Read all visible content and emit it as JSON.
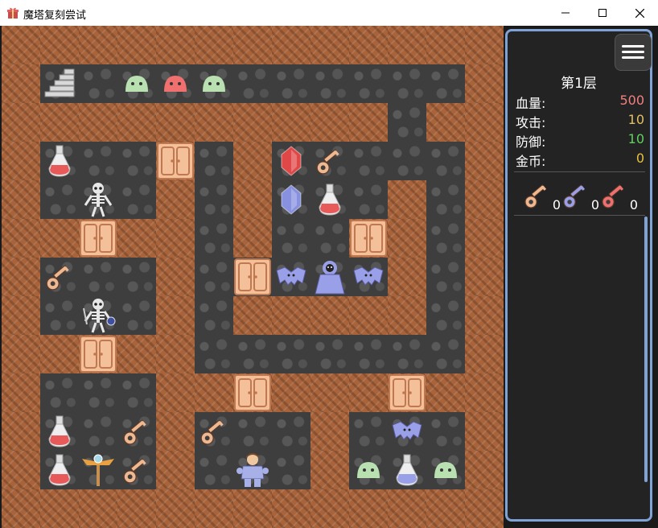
{
  "window": {
    "title": "魔塔复刻尝试",
    "icon": "gift-icon",
    "controls": [
      "minimize-icon",
      "maximize-icon",
      "close-icon"
    ]
  },
  "hud": {
    "floor": "第1层",
    "stats": [
      {
        "label": "血量:",
        "value": "500",
        "color": "#f08080"
      },
      {
        "label": "攻击:",
        "value": "10",
        "color": "#e0c060"
      },
      {
        "label": "防御:",
        "value": "10",
        "color": "#60d060"
      },
      {
        "label": "金币:",
        "value": "0",
        "color": "#e8c040"
      }
    ],
    "keys": [
      {
        "name": "yellow-key",
        "count": "0",
        "color": "#f0b890"
      },
      {
        "name": "blue-key",
        "count": "0",
        "color": "#9aa0e8"
      },
      {
        "name": "red-key",
        "count": "0",
        "color": "#f07070"
      }
    ]
  },
  "map": {
    "legend": {
      "W": "wall",
      "F": "floor"
    },
    "grid": [
      "WWWWWWWWWWWWW",
      "WFFFFFFFFFFFW",
      "WWWWWWWWWWFWW",
      "WFFFWFWFFFFFW",
      "WFFFWFWFFFWFW",
      "WWWWWFWFFWWFW",
      "WFFFWFFFFFWFW",
      "WFFFWFWWWWWFW",
      "WWWWWFFFFFFFW",
      "WFFFWWWWWWWWW",
      "WFFFWFFFWFFFW",
      "WFFFWFFFWFFFW",
      "WWWWWWWWWWWWW"
    ],
    "entities": [
      {
        "name": "upstairs",
        "row": 1,
        "col": 1,
        "color": "#d8d8d8"
      },
      {
        "name": "green-slime",
        "row": 1,
        "col": 3,
        "color": "#b8e0b0"
      },
      {
        "name": "red-slime",
        "row": 1,
        "col": 4,
        "color": "#f07070"
      },
      {
        "name": "green-slime",
        "row": 1,
        "col": 5,
        "color": "#b8e0b0"
      },
      {
        "name": "red-potion",
        "row": 3,
        "col": 1,
        "color": "#e85a5a"
      },
      {
        "name": "yellow-door",
        "row": 3,
        "col": 4,
        "color": "#f4c09a"
      },
      {
        "name": "red-gem",
        "row": 3,
        "col": 7,
        "color": "#e04848"
      },
      {
        "name": "yellow-key",
        "row": 3,
        "col": 8,
        "color": "#f0b890"
      },
      {
        "name": "skeleton",
        "row": 4,
        "col": 2,
        "color": "#e8e8e8"
      },
      {
        "name": "blue-gem",
        "row": 4,
        "col": 7,
        "color": "#8890e0"
      },
      {
        "name": "red-potion",
        "row": 4,
        "col": 8,
        "color": "#e85a5a"
      },
      {
        "name": "yellow-door",
        "row": 5,
        "col": 2,
        "color": "#f4c09a"
      },
      {
        "name": "yellow-door",
        "row": 5,
        "col": 9,
        "color": "#f4c09a"
      },
      {
        "name": "yellow-key",
        "row": 6,
        "col": 1,
        "color": "#f0b890"
      },
      {
        "name": "yellow-door",
        "row": 6,
        "col": 6,
        "color": "#f4c09a"
      },
      {
        "name": "bat",
        "row": 6,
        "col": 7,
        "color": "#9aa0e8"
      },
      {
        "name": "priest",
        "row": 6,
        "col": 8,
        "color": "#9aa0e8"
      },
      {
        "name": "bat",
        "row": 6,
        "col": 9,
        "color": "#9aa0e8"
      },
      {
        "name": "skeleton-soldier",
        "row": 7,
        "col": 2,
        "color": "#e8e8e8"
      },
      {
        "name": "yellow-door",
        "row": 8,
        "col": 2,
        "color": "#f4c09a"
      },
      {
        "name": "yellow-door",
        "row": 9,
        "col": 6,
        "color": "#f4c09a"
      },
      {
        "name": "yellow-door",
        "row": 9,
        "col": 10,
        "color": "#f4c09a"
      },
      {
        "name": "red-potion",
        "row": 10,
        "col": 1,
        "color": "#e85a5a"
      },
      {
        "name": "yellow-key",
        "row": 10,
        "col": 3,
        "color": "#f0b890"
      },
      {
        "name": "yellow-key",
        "row": 10,
        "col": 5,
        "color": "#f0b890"
      },
      {
        "name": "bat",
        "row": 10,
        "col": 10,
        "color": "#9aa0e8"
      },
      {
        "name": "red-potion",
        "row": 11,
        "col": 1,
        "color": "#e85a5a"
      },
      {
        "name": "winged-staff",
        "row": 11,
        "col": 2,
        "color": "#c89050"
      },
      {
        "name": "yellow-key",
        "row": 11,
        "col": 3,
        "color": "#f0b890"
      },
      {
        "name": "hero",
        "row": 11,
        "col": 6,
        "color": "#a8b0e8"
      },
      {
        "name": "green-slime",
        "row": 11,
        "col": 9,
        "color": "#b8e0b0"
      },
      {
        "name": "blue-potion",
        "row": 11,
        "col": 10,
        "color": "#9aa0e8"
      },
      {
        "name": "green-slime",
        "row": 11,
        "col": 11,
        "color": "#b8e0b0"
      }
    ]
  }
}
